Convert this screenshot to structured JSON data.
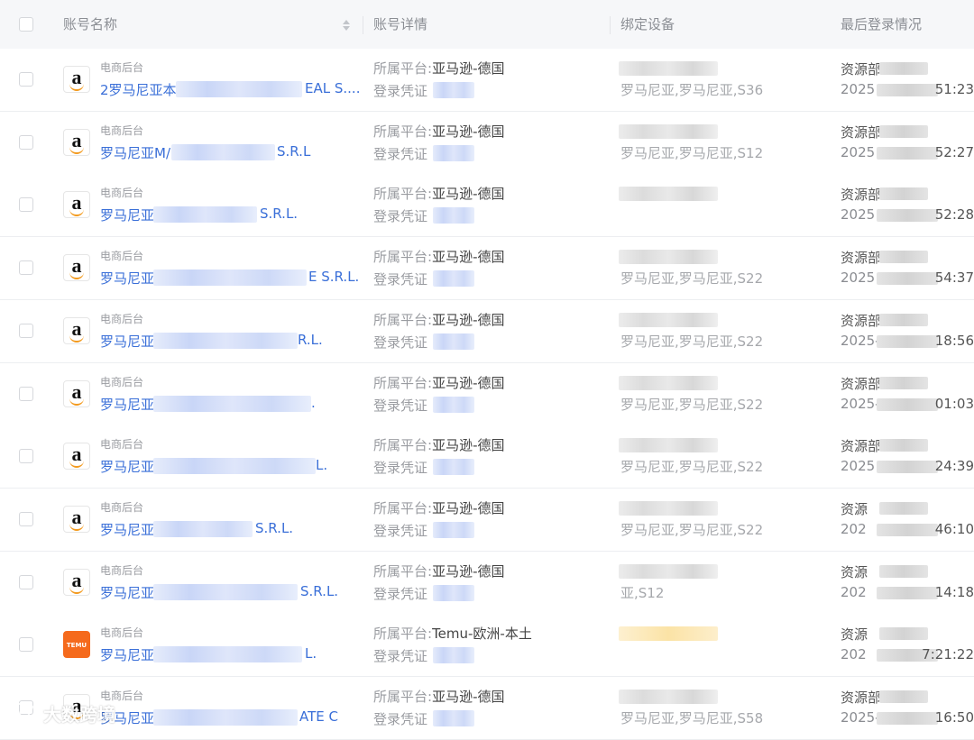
{
  "header": {
    "col_name": "账号名称",
    "col_detail": "账号详情",
    "col_device": "绑定设备",
    "col_login": "最后登录情况"
  },
  "rows": [
    {
      "logo": "amazon",
      "category": "电商后台",
      "name_start": "2罗马尼亚本",
      "name_end": "EAL S....",
      "platform_label": "所属平台:",
      "platform": "亚马逊-德国",
      "cred_label": "登录凭证",
      "device": "罗马尼亚,罗马尼亚,S36",
      "login_user": "资源部",
      "login_time_start": "2025",
      "login_time_end": "51:23"
    },
    {
      "logo": "amazon",
      "category": "电商后台",
      "name_start": "罗马尼亚M/",
      "name_end": "S.R.L",
      "platform_label": "所属平台:",
      "platform": "亚马逊-德国",
      "cred_label": "登录凭证",
      "device": "罗马尼亚,罗马尼亚,S12",
      "login_user": "资源部",
      "login_time_start": "2025",
      "login_time_end": "52:27"
    },
    {
      "logo": "amazon",
      "category": "电商后台",
      "name_start": "罗马尼亚",
      "name_end": "S.R.L.",
      "platform_label": "所属平台:",
      "platform": "亚马逊-德国",
      "cred_label": "登录凭证",
      "device": "",
      "login_user": "资源部",
      "login_time_start": "2025",
      "login_time_end": "52:28"
    },
    {
      "logo": "amazon",
      "category": "电商后台",
      "name_start": "罗马尼亚",
      "name_end": "E S.R.L.",
      "platform_label": "所属平台:",
      "platform": "亚马逊-德国",
      "cred_label": "登录凭证",
      "device": "罗马尼亚,罗马尼亚,S22",
      "login_user": "资源部",
      "login_time_start": "2025",
      "login_time_end": "54:37"
    },
    {
      "logo": "amazon",
      "category": "电商后台",
      "name_start": "罗马尼亚",
      "name_end": "R.L.",
      "platform_label": "所属平台:",
      "platform": "亚马逊-德国",
      "cred_label": "登录凭证",
      "device": "罗马尼亚,罗马尼亚,S22",
      "login_user": "资源部",
      "login_time_start": "2025-",
      "login_time_end": "18:56"
    },
    {
      "logo": "amazon",
      "category": "电商后台",
      "name_start": "罗马尼亚",
      "name_end": ".",
      "platform_label": "所属平台:",
      "platform": "亚马逊-德国",
      "cred_label": "登录凭证",
      "device": "罗马尼亚,罗马尼亚,S22",
      "login_user": "资源部",
      "login_time_start": "2025-",
      "login_time_end": "01:03"
    },
    {
      "logo": "amazon",
      "category": "电商后台",
      "name_start": "罗马尼亚",
      "name_end": "L.",
      "platform_label": "所属平台:",
      "platform": "亚马逊-德国",
      "cred_label": "登录凭证",
      "device": "罗马尼亚,罗马尼亚,S22",
      "login_user": "资源部",
      "login_time_start": "2025",
      "login_time_end": "24:39"
    },
    {
      "logo": "amazon",
      "category": "电商后台",
      "name_start": "罗马尼亚",
      "name_end": "S.R.L.",
      "platform_label": "所属平台:",
      "platform": "亚马逊-德国",
      "cred_label": "登录凭证",
      "device": "罗马尼亚,罗马尼亚,S22",
      "login_user": "资源",
      "login_time_start": "202",
      "login_time_end": "46:10"
    },
    {
      "logo": "amazon",
      "category": "电商后台",
      "name_start": "罗马尼亚",
      "name_end": "S.R.L.",
      "platform_label": "所属平台:",
      "platform": "亚马逊-德国",
      "cred_label": "登录凭证",
      "device": "亚,S12",
      "login_user": "资源",
      "login_time_start": "202",
      "login_time_end": "14:18"
    },
    {
      "logo": "temu",
      "logo_text": "TEMU",
      "category": "电商后台",
      "name_start": "罗马尼亚",
      "name_end": "L.",
      "platform_label": "所属平台:",
      "platform": "Temu-欧洲-本土",
      "cred_label": "登录凭证",
      "device": "",
      "login_user": "资源",
      "login_time_start": "202",
      "login_time_end": "7:21:22"
    },
    {
      "logo": "amazon",
      "category": "电商后台",
      "name_start": "罗马尼亚",
      "name_end": "ATE C",
      "platform_label": "所属平台:",
      "platform": "亚马逊-德国",
      "cred_label": "登录凭证",
      "device": "罗马尼亚,罗马尼亚,S58",
      "login_user": "资源部",
      "login_time_start": "2025-0",
      "login_time_end": "16:50"
    }
  ],
  "watermark": "大数跨境",
  "colors": {
    "link": "#3a6fd8",
    "header_bg": "#f6f7f9",
    "amazon_smile": "#f39a1e",
    "temu": "#f56a1c"
  }
}
